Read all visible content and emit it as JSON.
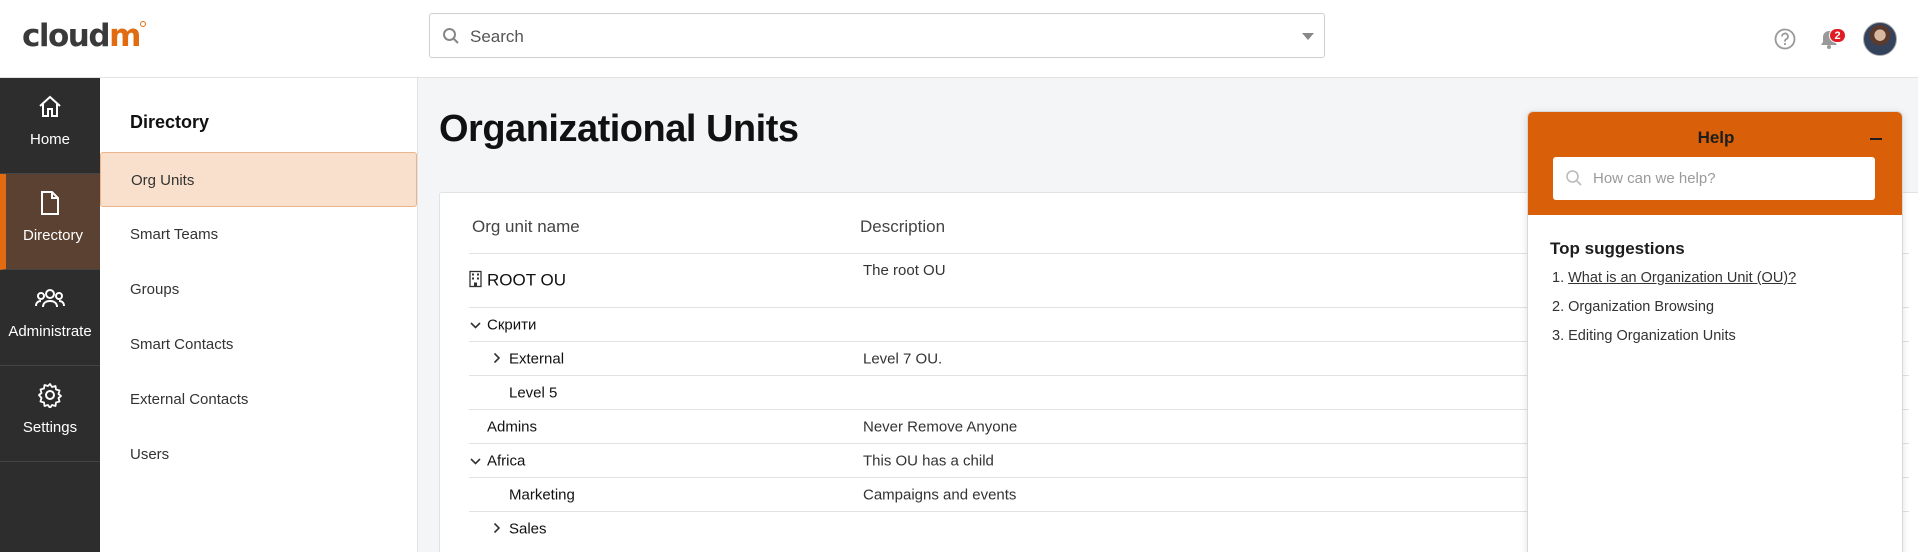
{
  "brand": {
    "logo_main": "cloud",
    "logo_accent": "m"
  },
  "header": {
    "search_placeholder": "Search",
    "notifications_count": "2"
  },
  "leftnav": [
    {
      "label": "Home",
      "icon": "home-icon",
      "active": false
    },
    {
      "label": "Directory",
      "icon": "document-icon",
      "active": true
    },
    {
      "label": "Administrate",
      "icon": "users-icon",
      "active": false
    },
    {
      "label": "Settings",
      "icon": "gear-icon",
      "active": false
    }
  ],
  "subnav": {
    "heading": "Directory",
    "items": [
      {
        "label": "Org Units",
        "active": true
      },
      {
        "label": "Smart Teams",
        "active": false
      },
      {
        "label": "Groups",
        "active": false
      },
      {
        "label": "Smart Contacts",
        "active": false
      },
      {
        "label": "External Contacts",
        "active": false
      },
      {
        "label": "Users",
        "active": false
      }
    ]
  },
  "main": {
    "title": "Organizational Units",
    "columns": {
      "name": "Org unit name",
      "description": "Description"
    },
    "rows": [
      {
        "name": "ROOT OU",
        "description": "The root OU",
        "indent": 0,
        "chevron": "",
        "icon": "building-icon"
      },
      {
        "name": "Скрити",
        "description": "",
        "indent": 0,
        "chevron": "down"
      },
      {
        "name": "External",
        "description": "Level 7 OU.",
        "indent": 1,
        "chevron": "right"
      },
      {
        "name": "Level 5",
        "description": "",
        "indent": 1,
        "chevron": ""
      },
      {
        "name": "Admins",
        "description": "Never Remove Anyone",
        "indent": 0,
        "chevron": ""
      },
      {
        "name": "Africa",
        "description": "This OU has a child",
        "indent": 0,
        "chevron": "down"
      },
      {
        "name": "Marketing",
        "description": "Campaigns and events",
        "indent": 1,
        "chevron": ""
      },
      {
        "name": "Sales",
        "description": "",
        "indent": 1,
        "chevron": "right"
      }
    ]
  },
  "help": {
    "title": "Help",
    "search_placeholder": "How can we help?",
    "suggestions_heading": "Top suggestions",
    "suggestions": [
      {
        "num": "1.",
        "label": "What is an Organization Unit (OU)?",
        "link": true
      },
      {
        "num": "2.",
        "label": "Organization Browsing",
        "link": false
      },
      {
        "num": "3.",
        "label": "Editing Organization Units",
        "link": false
      }
    ]
  },
  "colors": {
    "accent": "#e06b10",
    "help_header": "#d96008",
    "nav_bg": "#2d2d2d",
    "active_sub_bg": "#f9e0cc"
  }
}
